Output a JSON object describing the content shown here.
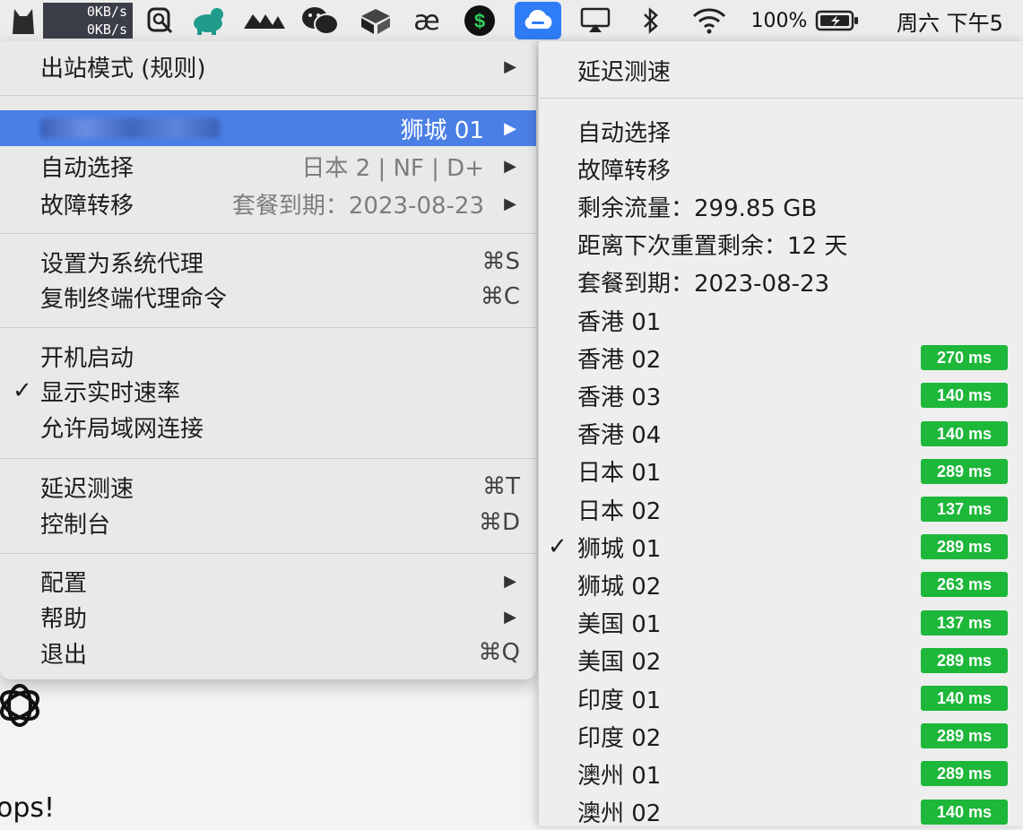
{
  "menubar": {
    "speed_up": "0KB/s",
    "speed_down": "0KB/s",
    "icons": [
      "app-icon",
      "search-icon",
      "dog-icon",
      "fox-icon",
      "wechat-icon",
      "box-icon",
      "ae-icon",
      "dollar-icon",
      "cloud-icon",
      "airplay-icon",
      "bluetooth-icon",
      "wifi-icon"
    ],
    "battery": "100%",
    "clock": "周六 下午5"
  },
  "menu": {
    "outbound_mode": "出站模式 (规则)",
    "server_selected": "狮城 01",
    "auto_select": "自动选择",
    "auto_select_value": "日本 2 | NF | D+",
    "failover": "故障转移",
    "failover_value": "套餐到期：2023-08-23",
    "set_system_proxy": "设置为系统代理",
    "set_system_proxy_sc": "⌘S",
    "copy_terminal_cmd": "复制终端代理命令",
    "copy_terminal_cmd_sc": "⌘C",
    "launch_at_login": "开机启动",
    "show_speed": "显示实时速率",
    "allow_lan": "允许局域网连接",
    "latency_test": "延迟测速",
    "latency_test_sc": "⌘T",
    "console": "控制台",
    "console_sc": "⌘D",
    "config": "配置",
    "help": "帮助",
    "quit": "退出",
    "quit_sc": "⌘Q"
  },
  "submenu": {
    "latency_test": "延迟测速",
    "info": [
      "自动选择",
      "故障转移",
      "剩余流量：299.85 GB",
      "距离下次重置剩余：12 天",
      "套餐到期：2023-08-23"
    ],
    "nodes": [
      {
        "name": "香港 01",
        "latency": ""
      },
      {
        "name": "香港 02",
        "latency": "270 ms"
      },
      {
        "name": "香港 03",
        "latency": "140 ms"
      },
      {
        "name": "香港 04",
        "latency": "140 ms"
      },
      {
        "name": "日本 01",
        "latency": "289 ms"
      },
      {
        "name": "日本 02",
        "latency": "137 ms"
      },
      {
        "name": "狮城 01",
        "latency": "289 ms",
        "selected": true
      },
      {
        "name": "狮城 02",
        "latency": "263 ms"
      },
      {
        "name": "美国 01",
        "latency": "137 ms"
      },
      {
        "name": "美国 02",
        "latency": "289 ms"
      },
      {
        "name": "印度 01",
        "latency": "140 ms"
      },
      {
        "name": "印度 02",
        "latency": "289 ms"
      },
      {
        "name": "澳州 01",
        "latency": "289 ms"
      },
      {
        "name": "澳州 02",
        "latency": "140 ms"
      }
    ],
    "check_mark": "✓"
  },
  "background": {
    "partial_text": "ops!"
  },
  "colors": {
    "badge_green": "#1db73a",
    "highlight_blue": "#4a7fe6"
  }
}
